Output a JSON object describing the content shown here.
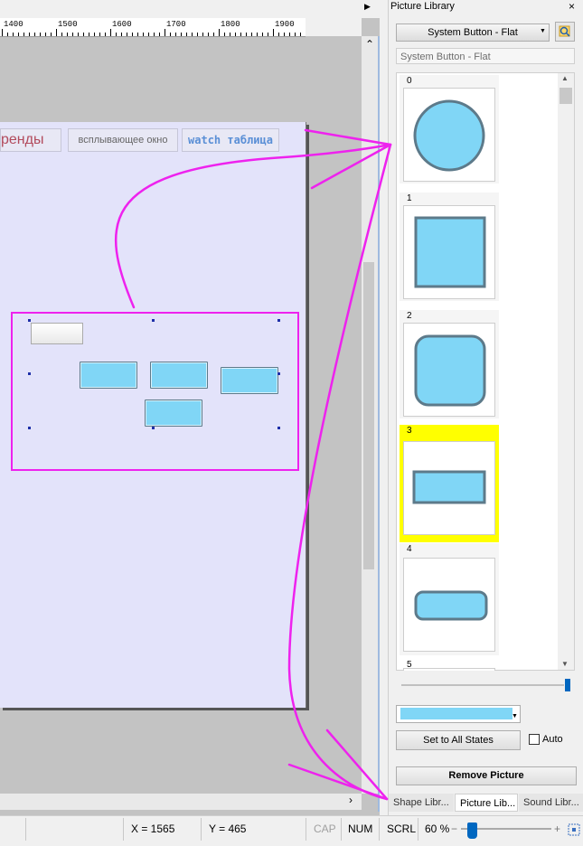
{
  "ruler": {
    "labels": [
      "1400",
      "1500",
      "1600",
      "1700",
      "1800",
      "1900"
    ]
  },
  "canvas": {
    "tabs": {
      "trends": "ренды",
      "popup": "всплывающее окно",
      "watch": "watch таблица"
    }
  },
  "panel": {
    "title": "Picture Library",
    "close_glyph": "×",
    "library_selector": "System Button - Flat",
    "library_name_field": "System Button - Flat",
    "pictures": [
      {
        "index": "0",
        "shape": "circle"
      },
      {
        "index": "1",
        "shape": "square"
      },
      {
        "index": "2",
        "shape": "rounded-square"
      },
      {
        "index": "3",
        "shape": "rectangle",
        "selected": true
      },
      {
        "index": "4",
        "shape": "pill"
      },
      {
        "index": "5",
        "shape": "unknown"
      }
    ],
    "picture_zoom": 1.0,
    "fill_color": "#80d6f6",
    "set_all_label": "Set to All States",
    "auto_label": "Auto",
    "remove_label": "Remove Picture",
    "tabs": {
      "shape": "Shape Libr...",
      "picture": "Picture Lib...",
      "sound": "Sound Libr..."
    }
  },
  "statusbar": {
    "x": "X = 1565",
    "y": "Y = 465",
    "cap": "CAP",
    "num": "NUM",
    "scrl": "SCRL",
    "zoom": "60 %",
    "zoom_minus": "−",
    "zoom_plus": "+"
  },
  "colors": {
    "highlight": "#ee22ee",
    "selected_bg": "#ffff00",
    "button_fill": "#80d6f6"
  }
}
